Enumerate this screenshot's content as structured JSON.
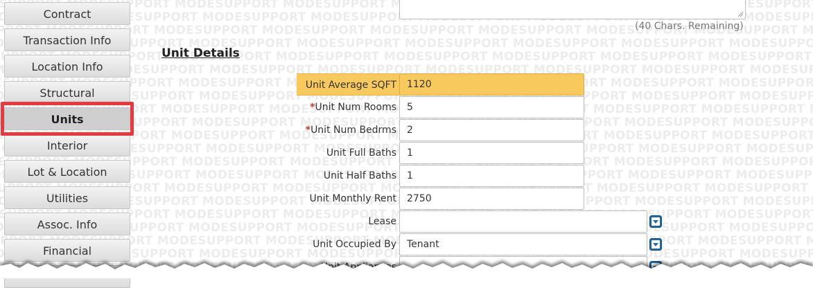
{
  "watermark_text": "MODESUPPORT MODESUPPORT MODESUPPORT MODESUPPORT MODESUPPORT MODESUPPORT MODESUPPORT MODESUPPORT MODESUPPORT",
  "sidebar": {
    "items": [
      {
        "label": "Contract"
      },
      {
        "label": "Transaction Info"
      },
      {
        "label": "Location Info"
      },
      {
        "label": "Structural"
      },
      {
        "label": "Units"
      },
      {
        "label": "Interior"
      },
      {
        "label": "Lot & Location"
      },
      {
        "label": "Utilities"
      },
      {
        "label": "Assoc. Info"
      },
      {
        "label": "Financial"
      }
    ],
    "active": "Units"
  },
  "remarks": {
    "chars_remaining": "(40 Chars. Remaining)"
  },
  "section": {
    "title": "Unit Details"
  },
  "fields": {
    "unit_avg_sqft": {
      "label": "Unit Average SQFT",
      "value": "1120"
    },
    "unit_num_rooms": {
      "required_mark": "*",
      "label": "Unit Num Rooms",
      "value": "5"
    },
    "unit_num_bedrms": {
      "required_mark": "*",
      "label": "Unit Num Bedrms",
      "value": "2"
    },
    "unit_full_baths": {
      "label": "Unit Full Baths",
      "value": "1"
    },
    "unit_half_baths": {
      "label": "Unit Half Baths",
      "value": "1"
    },
    "unit_monthly_rent": {
      "label": "Unit Monthly Rent",
      "value": "2750"
    },
    "lease": {
      "label": "Lease",
      "value": ""
    },
    "unit_occupied_by": {
      "label": "Unit Occupied By",
      "value": "Tenant"
    },
    "unit_appliances": {
      "label": "Unit Appliances",
      "value": ""
    }
  },
  "colors": {
    "highlight": "#f8c95c",
    "active_outline": "#e53a3f",
    "dropdown_button": "#1f6aa5"
  }
}
